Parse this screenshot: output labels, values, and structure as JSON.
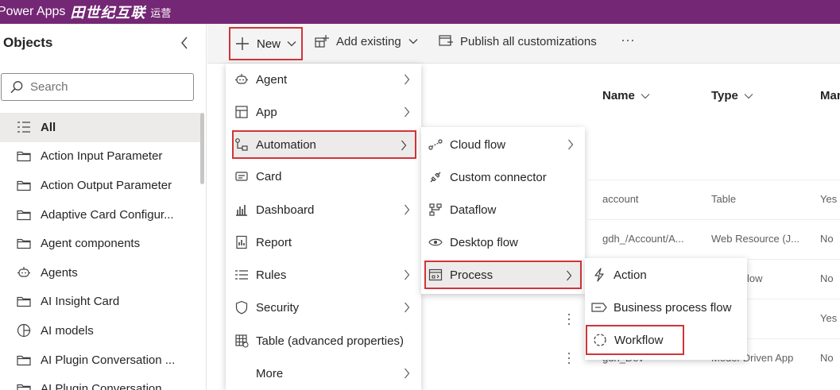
{
  "topbar": {
    "app_name": "Power Apps",
    "env_brand": "田世纪互联",
    "env_suffix": "运营"
  },
  "sidebar": {
    "title": "Objects",
    "search_placeholder": "Search",
    "items": [
      {
        "label": "All",
        "icon": "list-icon",
        "selected": true
      },
      {
        "label": "Action Input Parameter",
        "icon": "folder-icon"
      },
      {
        "label": "Action Output Parameter",
        "icon": "folder-icon"
      },
      {
        "label": "Adaptive Card Configur...",
        "icon": "folder-icon"
      },
      {
        "label": "Agent components",
        "icon": "folder-icon"
      },
      {
        "label": "Agents",
        "icon": "agent-icon"
      },
      {
        "label": "AI Insight Card",
        "icon": "folder-icon"
      },
      {
        "label": "AI models",
        "icon": "ai-model-icon"
      },
      {
        "label": "AI Plugin Conversation ...",
        "icon": "folder-icon"
      },
      {
        "label": "AI Plugin Conversation",
        "icon": "folder-icon"
      }
    ]
  },
  "commandbar": {
    "new_label": "New",
    "add_existing_label": "Add existing",
    "publish_label": "Publish all customizations",
    "more_label": "···"
  },
  "new_menu": [
    {
      "label": "Agent",
      "icon": "agent-icon",
      "submenu": true
    },
    {
      "label": "App",
      "icon": "app-icon",
      "submenu": true
    },
    {
      "label": "Automation",
      "icon": "automation-icon",
      "submenu": true,
      "active": true
    },
    {
      "label": "Card",
      "icon": "card-icon",
      "submenu": false
    },
    {
      "label": "Dashboard",
      "icon": "dashboard-icon",
      "submenu": true
    },
    {
      "label": "Report",
      "icon": "report-icon",
      "submenu": false
    },
    {
      "label": "Rules",
      "icon": "rules-icon",
      "submenu": true
    },
    {
      "label": "Security",
      "icon": "shield-icon",
      "submenu": true
    },
    {
      "label": "Table (advanced properties)",
      "icon": "table-icon",
      "submenu": false
    },
    {
      "label": "More",
      "icon": "",
      "submenu": true
    }
  ],
  "automation_menu": [
    {
      "label": "Cloud flow",
      "icon": "cloud-flow-icon",
      "submenu": true
    },
    {
      "label": "Custom connector",
      "icon": "connector-icon",
      "submenu": false
    },
    {
      "label": "Dataflow",
      "icon": "dataflow-icon",
      "submenu": false
    },
    {
      "label": "Desktop flow",
      "icon": "desktop-flow-icon",
      "submenu": false
    },
    {
      "label": "Process",
      "icon": "process-icon",
      "submenu": true,
      "active": true
    }
  ],
  "process_menu": [
    {
      "label": "Action",
      "icon": "lightning-icon"
    },
    {
      "label": "Business process flow",
      "icon": "bpf-icon"
    },
    {
      "label": "Workflow",
      "icon": "workflow-icon",
      "highlighted": true
    }
  ],
  "grid": {
    "columns": {
      "name": "Name",
      "type": "Type",
      "managed": "Man"
    },
    "rows": [
      {
        "name": "account",
        "type": "Table",
        "managed": "Yes"
      },
      {
        "name": "gdh_/Account/A...",
        "type": "Web Resource (J...",
        "managed": "No"
      },
      {
        "name": "",
        "type": "low",
        "managed": "No"
      },
      {
        "name": "",
        "type": "",
        "managed": "Yes"
      },
      {
        "name": "gdh_Dev",
        "type": "Model-Driven App",
        "managed": "No"
      }
    ]
  },
  "colors": {
    "header_bg": "#742774",
    "highlight": "#d13438",
    "selected_bg": "#edebe9"
  }
}
